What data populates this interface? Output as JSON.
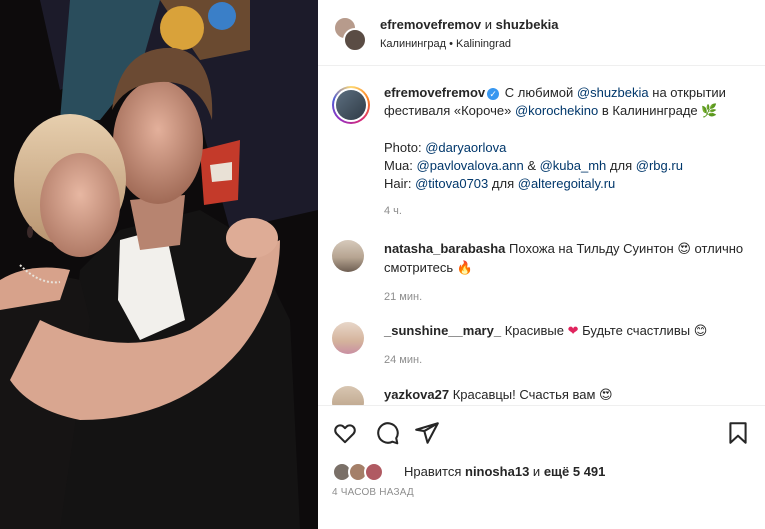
{
  "header": {
    "user1": "efremovefremov",
    "connector": "и",
    "user2": "shuzbekia",
    "location": "Калининград • Kaliningrad"
  },
  "caption": {
    "username": "efremovefremov",
    "verified_icon": "check",
    "t1": "С любимой",
    "m1": "@shuzbekia",
    "t2": "на открытии фестиваля «Короче»",
    "m2": "@korochekino",
    "t3": "в Калининграде",
    "emoji": "🌿",
    "photo_label": "Photo:",
    "photo_mention": "@daryaorlova",
    "mua_label": "Mua:",
    "mua_m1": "@pavlovalova.ann",
    "mua_amp": "&",
    "mua_m2": "@kuba_mh",
    "mua_for": "для",
    "mua_m3": "@rbg.ru",
    "hair_label": "Hair:",
    "hair_m1": "@titova0703",
    "hair_for": "для",
    "hair_m2": "@alteregoitaly.ru",
    "time": "4 ч."
  },
  "comments": [
    {
      "username": "natasha_barabasha",
      "text": "Похожа на Тильду Суинтон",
      "emoji": "😍",
      "text2": "отлично смотритесь",
      "emoji2": "🔥",
      "time": "21 мин."
    },
    {
      "username": "_sunshine__mary_",
      "text": "Красивые",
      "emoji": "❤",
      "text2": "Будьте счастливы",
      "emoji2": "😊",
      "time": "24 мин."
    },
    {
      "username": "yazkova27",
      "text": "Красавцы! Счастья вам",
      "emoji": "😍",
      "text2": "",
      "emoji2": "",
      "time": ""
    }
  ],
  "actions": {
    "like_icon": "heart-outline",
    "comment_icon": "comment-bubble",
    "share_icon": "paper-plane",
    "save_icon": "bookmark"
  },
  "likes": {
    "prefix": "Нравится",
    "user": "ninosha13",
    "middle": "и",
    "others": "ещё 5 491"
  },
  "posted": "4 ЧАСОВ НАЗАД",
  "colors": {
    "link": "#00376b",
    "muted": "#8e8e8e",
    "verified": "#3897f0"
  }
}
